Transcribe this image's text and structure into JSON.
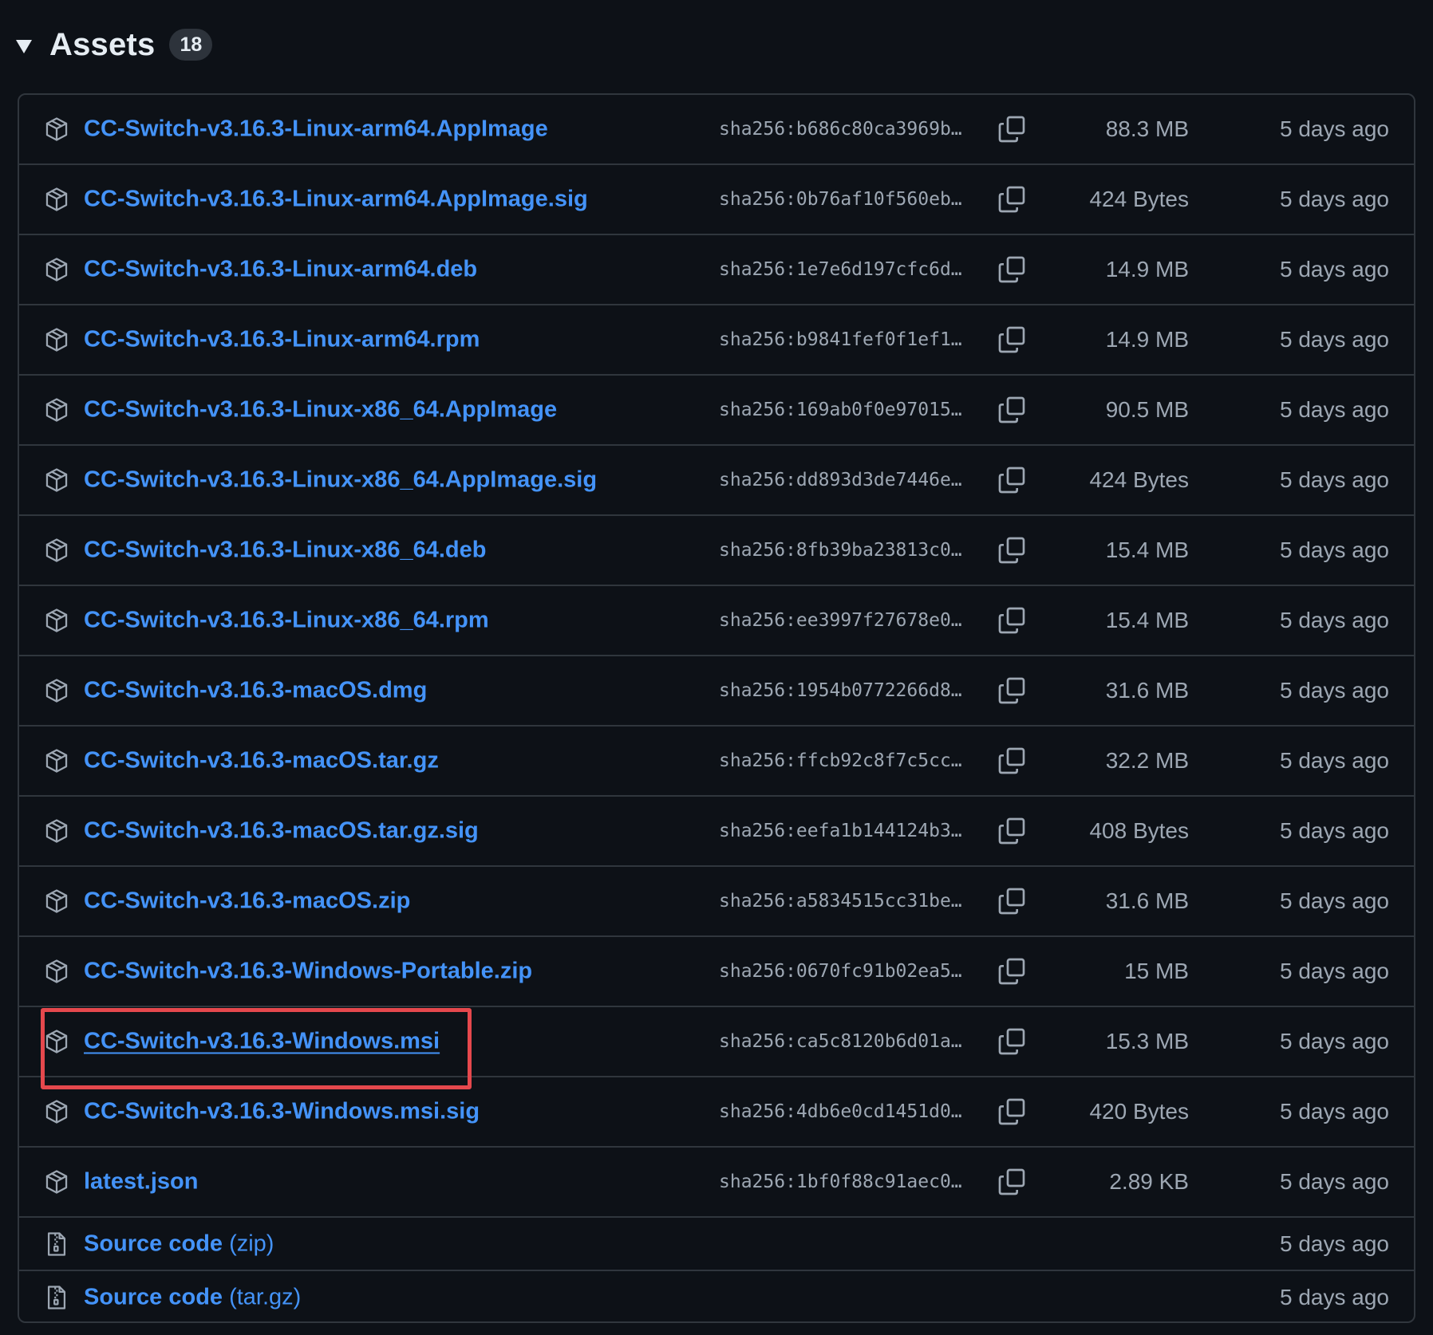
{
  "header": {
    "title": "Assets",
    "count": "18"
  },
  "assets": [
    {
      "name": "CC-Switch-v3.16.3-Linux-arm64.AppImage",
      "sha": "sha256:b686c80ca3969b…",
      "size": "88.3 MB",
      "date": "5 days ago"
    },
    {
      "name": "CC-Switch-v3.16.3-Linux-arm64.AppImage.sig",
      "sha": "sha256:0b76af10f560eb…",
      "size": "424 Bytes",
      "date": "5 days ago"
    },
    {
      "name": "CC-Switch-v3.16.3-Linux-arm64.deb",
      "sha": "sha256:1e7e6d197cfc6d…",
      "size": "14.9 MB",
      "date": "5 days ago"
    },
    {
      "name": "CC-Switch-v3.16.3-Linux-arm64.rpm",
      "sha": "sha256:b9841fef0f1ef1…",
      "size": "14.9 MB",
      "date": "5 days ago"
    },
    {
      "name": "CC-Switch-v3.16.3-Linux-x86_64.AppImage",
      "sha": "sha256:169ab0f0e97015…",
      "size": "90.5 MB",
      "date": "5 days ago"
    },
    {
      "name": "CC-Switch-v3.16.3-Linux-x86_64.AppImage.sig",
      "sha": "sha256:dd893d3de7446e…",
      "size": "424 Bytes",
      "date": "5 days ago"
    },
    {
      "name": "CC-Switch-v3.16.3-Linux-x86_64.deb",
      "sha": "sha256:8fb39ba23813c0…",
      "size": "15.4 MB",
      "date": "5 days ago"
    },
    {
      "name": "CC-Switch-v3.16.3-Linux-x86_64.rpm",
      "sha": "sha256:ee3997f27678e0…",
      "size": "15.4 MB",
      "date": "5 days ago"
    },
    {
      "name": "CC-Switch-v3.16.3-macOS.dmg",
      "sha": "sha256:1954b0772266d8…",
      "size": "31.6 MB",
      "date": "5 days ago"
    },
    {
      "name": "CC-Switch-v3.16.3-macOS.tar.gz",
      "sha": "sha256:ffcb92c8f7c5cc…",
      "size": "32.2 MB",
      "date": "5 days ago"
    },
    {
      "name": "CC-Switch-v3.16.3-macOS.tar.gz.sig",
      "sha": "sha256:eefa1b144124b3…",
      "size": "408 Bytes",
      "date": "5 days ago"
    },
    {
      "name": "CC-Switch-v3.16.3-macOS.zip",
      "sha": "sha256:a5834515cc31be…",
      "size": "31.6 MB",
      "date": "5 days ago"
    },
    {
      "name": "CC-Switch-v3.16.3-Windows-Portable.zip",
      "sha": "sha256:0670fc91b02ea5…",
      "size": "15 MB",
      "date": "5 days ago"
    },
    {
      "name": "CC-Switch-v3.16.3-Windows.msi",
      "sha": "sha256:ca5c8120b6d01a…",
      "size": "15.3 MB",
      "date": "5 days ago"
    },
    {
      "name": "CC-Switch-v3.16.3-Windows.msi.sig",
      "sha": "sha256:4db6e0cd1451d0…",
      "size": "420 Bytes",
      "date": "5 days ago"
    },
    {
      "name": "latest.json",
      "sha": "sha256:1bf0f88c91aec0…",
      "size": "2.89 KB",
      "date": "5 days ago"
    }
  ],
  "source_code": [
    {
      "label": "Source code",
      "format": "(zip)",
      "date": "5 days ago"
    },
    {
      "label": "Source code",
      "format": "(tar.gz)",
      "date": "5 days ago"
    }
  ],
  "colors": {
    "background": "#0d1117",
    "border": "#30363d",
    "link": "#4493f8",
    "muted": "#9da7b3",
    "highlight": "#e5484d"
  },
  "icons": {
    "asset": "package-icon",
    "copy": "copy-icon",
    "source": "file-zip-icon",
    "toggle": "triangle-down-icon"
  }
}
